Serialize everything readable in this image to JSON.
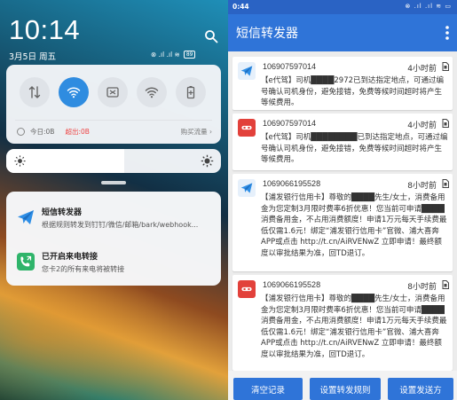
{
  "shade": {
    "clock": "10:14",
    "date": "3月5日  周五",
    "status_icons": "⊗ .ıl .ıl ≋",
    "battery": "89",
    "quick_tiles": [
      {
        "name": "data-transfer-icon",
        "active": false
      },
      {
        "name": "wifi-icon",
        "active": true
      },
      {
        "name": "screenshot-icon",
        "active": false
      },
      {
        "name": "hotspot-icon",
        "active": false
      },
      {
        "name": "battery-saver-icon",
        "active": false
      }
    ],
    "data_usage": {
      "today_label": "今日:0B",
      "exceeded_label": "超出:0B",
      "buy_label": "购买流量 ›"
    },
    "brightness_level": 0.55,
    "notifications": [
      {
        "title": "短信转发器",
        "text": "根据规则转发到钉钉/微信/邮箱/bark/webhook...",
        "icon": "paper-plane-icon"
      },
      {
        "title": "已开启来电转接",
        "text": "您卡2的所有来电将被转接",
        "icon": "phone-forward-icon"
      }
    ]
  },
  "app": {
    "status_time": "0:44",
    "status_icons": "⊗ .ıl .ıl ≋ ▭",
    "title": "短信转发器",
    "messages": [
      {
        "number": "106907597014",
        "time": "4小时前",
        "avatar": "paper-plane",
        "body": "【e代驾】司机████2972已到达指定地点，可通过编号确认司机身份，避免接错，免费等候时间超时将产生等候费用。"
      },
      {
        "number": "106907597014",
        "time": "4小时前",
        "avatar": "dingtalk",
        "body": "【e代驾】司机████████已到达指定地点，可通过编号确认司机身份，避免接错，免费等候时间超时将产生等候费用。"
      },
      {
        "number": "1069066195528",
        "time": "8小时前",
        "avatar": "paper-plane",
        "body": "【浦发银行信用卡】尊敬的████先生/女士，消费备用金为您定制3月限时费率6折优惠！您当前可申请████消费备用金，不占用消费额度！申请1万元每天手续费最低仅需1.6元！绑定“浦发银行信用卡”官微、浦大喜奔APP或点击 http://t.cn/AiRVENwZ 立即申请！最终额度以审批结果为准，回TD退订。"
      },
      {
        "number": "1069066195528",
        "time": "8小时前",
        "avatar": "dingtalk",
        "body": "【浦发银行信用卡】尊敬的████先生/女士，消费备用金为您定制3月限时费率6折优惠！您当前可申请████消费备用金，不占用消费额度！申请1万元每天手续费最低仅需1.6元！绑定“浦发银行信用卡”官微、浦大喜奔APP或点击 http://t.cn/AiRVENwZ 立即申请！最终额度以审批结果为准，回TD退订。"
      }
    ],
    "buttons": {
      "clear": "清空记录",
      "rules": "设置转发规则",
      "channels": "设置发送方"
    }
  },
  "colors": {
    "app_blue": "#2f74d8",
    "status_blue": "#2a63c4",
    "telegram_blue": "#2e8ee6",
    "dingtalk_red": "#e2413b",
    "tile_active": "#2f8ce0"
  }
}
